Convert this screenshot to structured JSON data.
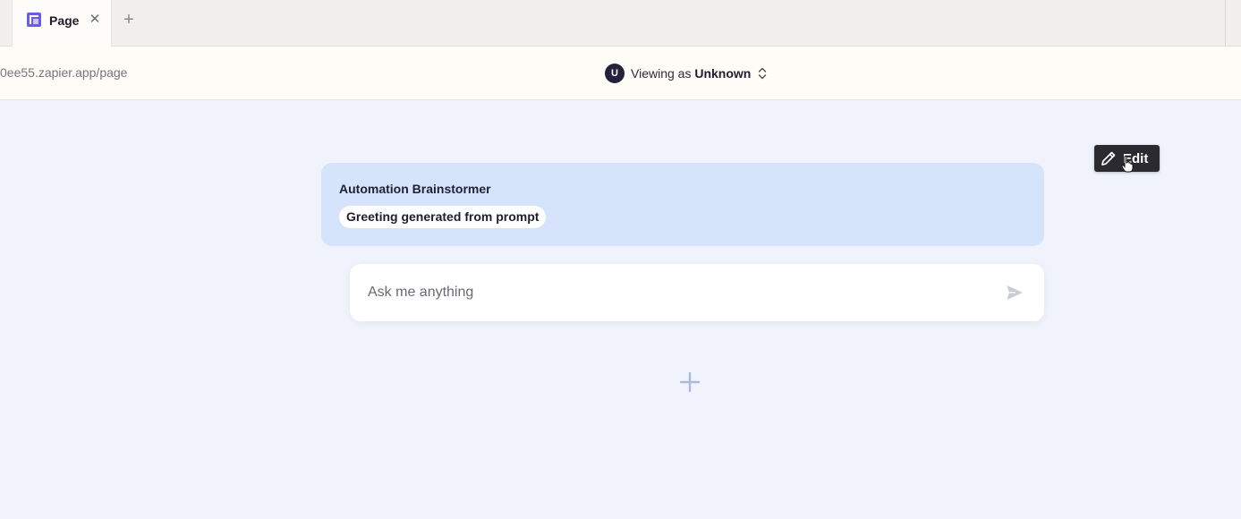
{
  "tabs": [
    {
      "label": "Page",
      "icon": "page-icon",
      "active": true
    }
  ],
  "tabbar": {
    "close_icon": "close-icon",
    "new_tab_icon": "plus-icon"
  },
  "address": {
    "url": "0ee55.zapier.app/page",
    "avatar_initial": "U",
    "viewing_prefix": "Viewing as ",
    "viewing_user": "Unknown"
  },
  "toolbar": {
    "edit_label": "Edit"
  },
  "chat": {
    "title": "Automation Brainstormer",
    "greeting": "Greeting generated from prompt",
    "input_placeholder": "Ask me anything",
    "input_value": ""
  },
  "colors": {
    "accent_icon": "#6b5ce7",
    "card_bg": "#d6e4fb",
    "page_bg": "#f0f3fc",
    "avatar_bg": "#24213a",
    "edit_bg": "#2b2a30",
    "add_icon": "#a9b9da"
  }
}
